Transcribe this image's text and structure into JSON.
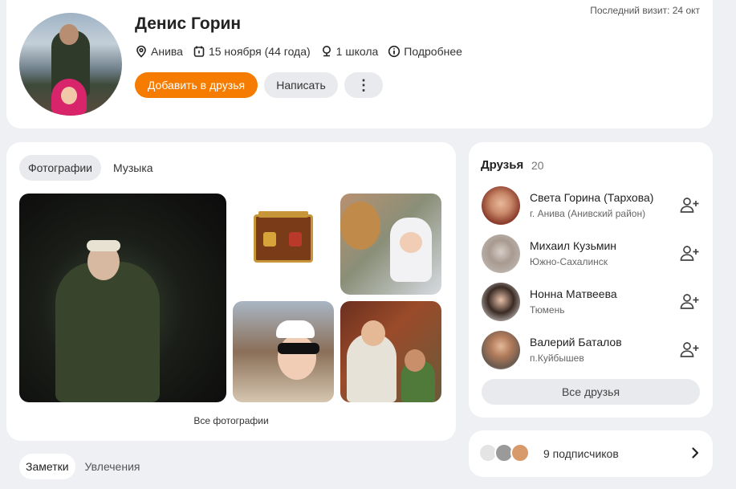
{
  "profile": {
    "name": "Денис Горин",
    "last_visit": "Последний визит: 24 окт",
    "location": "Анива",
    "birthday": "15 ноября (44 года)",
    "school": "1 школа",
    "details_link": "Подробнее",
    "add_friend_label": "Добавить в друзья",
    "message_label": "Написать",
    "more_label": "⋮",
    "icons": [
      "location-pin-icon",
      "calendar-icon",
      "school-icon",
      "info-icon"
    ]
  },
  "photos": {
    "tabs": [
      {
        "label": "Фотографии",
        "active": true
      },
      {
        "label": "Музыка",
        "active": false
      }
    ],
    "all_link": "Все фотографии"
  },
  "friends": {
    "title": "Друзья",
    "count": "20",
    "items": [
      {
        "name": "Света Горина (Тархова)",
        "location": "г. Анива (Анивский район)"
      },
      {
        "name": "Михаил Кузьмин",
        "location": "Южно-Сахалинск"
      },
      {
        "name": "Нонна Матвеева",
        "location": "Тюмень"
      },
      {
        "name": "Валерий Баталов",
        "location": "п.Куйбышев"
      }
    ],
    "all_label": "Все друзья",
    "add_icon": "add-friend-icon"
  },
  "subscribers": {
    "label": "9 подписчиков",
    "icon": "chevron-right-icon"
  },
  "bottom_tabs": [
    {
      "label": "Заметки",
      "active": true
    },
    {
      "label": "Увлечения",
      "active": false
    }
  ],
  "colors": {
    "accent": "#f57c00",
    "background": "#eef0f3",
    "button_secondary": "#e9eaed"
  }
}
